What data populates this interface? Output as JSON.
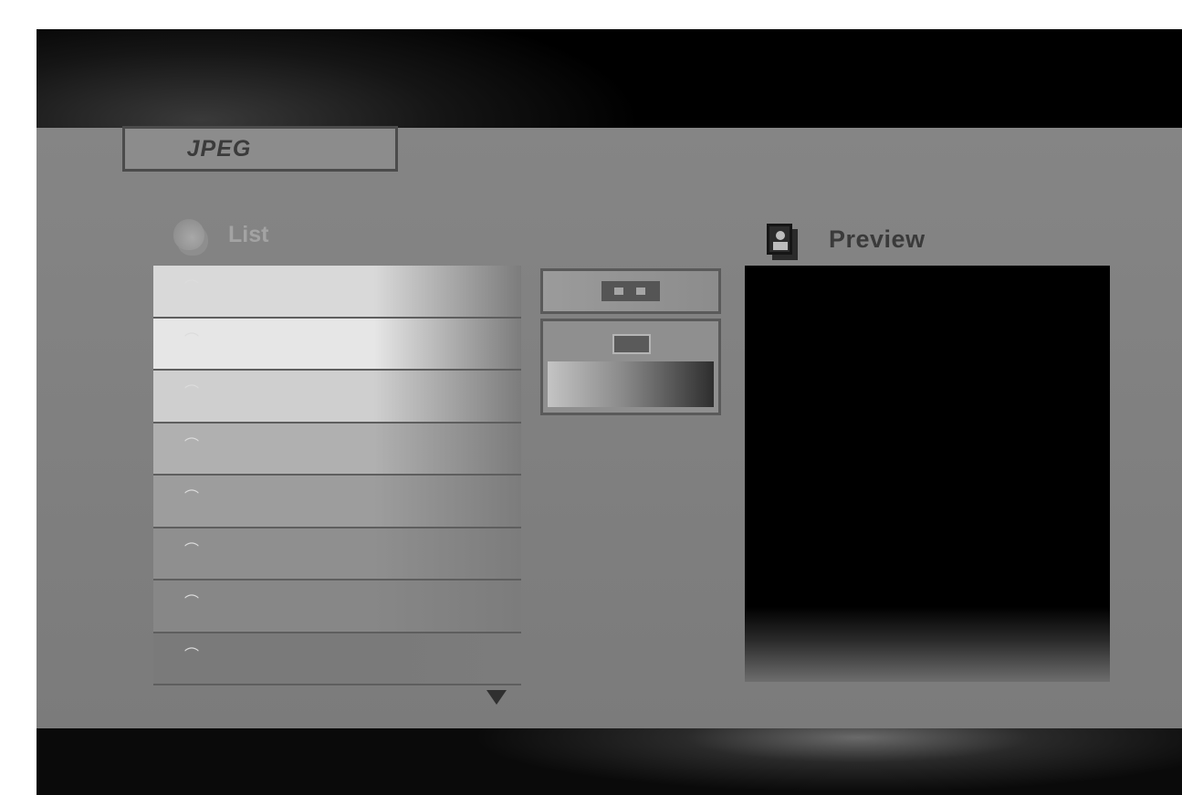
{
  "tab": {
    "label": "JPEG"
  },
  "list": {
    "title": "List",
    "rows": [
      {
        "glyph": "⌒",
        "shade": "#d9d9d9"
      },
      {
        "glyph": "⌒",
        "shade": "#e6e6e6"
      },
      {
        "glyph": "⌒",
        "shade": "#cfcfcf"
      },
      {
        "glyph": "⌒",
        "shade": "#b0b0b0"
      },
      {
        "glyph": "⌒",
        "shade": "#9d9d9d"
      },
      {
        "glyph": "⌒",
        "shade": "#8f8f8f"
      },
      {
        "glyph": "⌒",
        "shade": "#878787"
      },
      {
        "glyph": "⌒",
        "shade": "#7a7a7a"
      }
    ]
  },
  "preview": {
    "title": "Preview"
  },
  "icons": {
    "list": "photo-album-icon",
    "preview": "portrait-icon",
    "scroll": "arrow-down-icon",
    "btn1": "playback-icon",
    "btn2": "slideshow-icon"
  },
  "colors": {
    "panel": "#808080",
    "preview_bg": "#000000"
  }
}
